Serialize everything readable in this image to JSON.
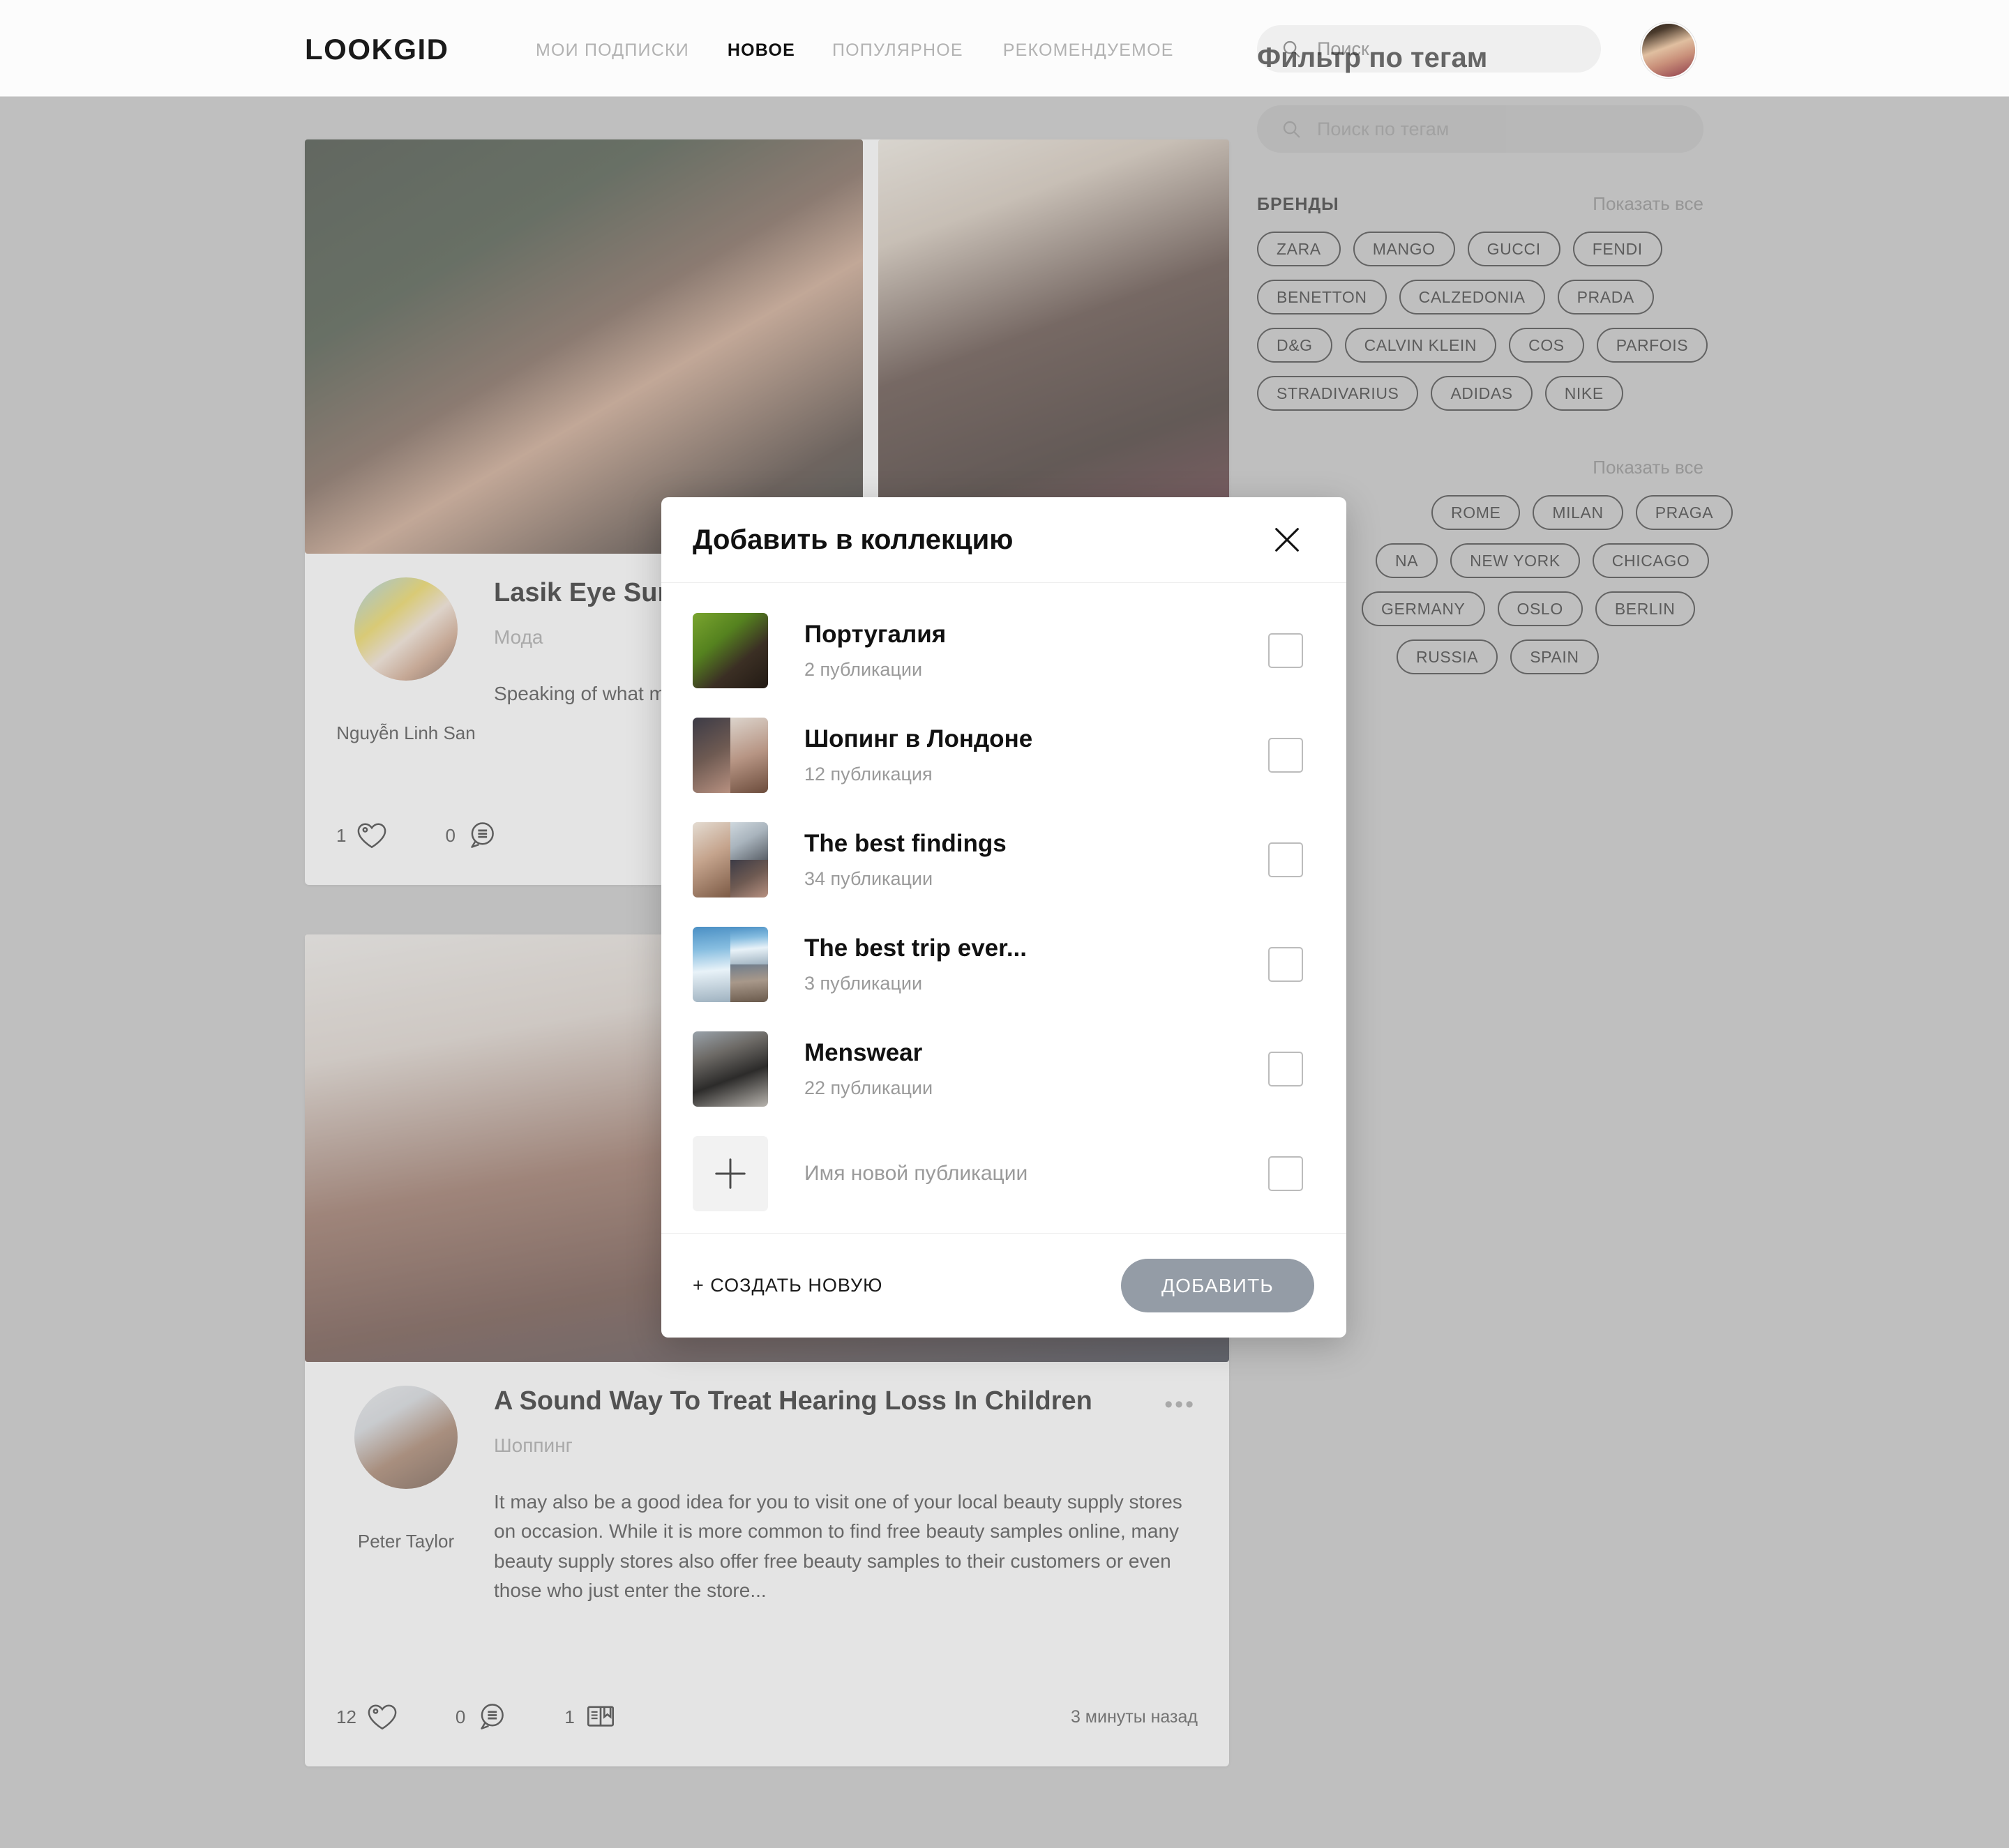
{
  "header": {
    "brand": "LOOKGID",
    "nav": [
      {
        "label": "МОИ ПОДПИСКИ",
        "active": false
      },
      {
        "label": "НОВОЕ",
        "active": true
      },
      {
        "label": "ПОПУЛЯРНОЕ",
        "active": false
      },
      {
        "label": "РЕКОМЕНДУЕМОЕ",
        "active": false
      }
    ],
    "search": {
      "placeholder": "Поиск",
      "value": "",
      "icon": "search-icon"
    },
    "avatar_icon": "user-avatar"
  },
  "feed": {
    "posts": [
      {
        "title": "Lasik Eye Surg",
        "category": "Мода",
        "author": "Nguyễn Linh San",
        "excerpt": "Speaking of what many benefits to beauty samples is different options. ",
        "likes": "1",
        "comments": "0",
        "reads": "",
        "time": ""
      },
      {
        "title": "A Sound Way To Treat Hearing Loss In Children",
        "category": "Шоппинг",
        "author": "Peter Taylor",
        "excerpt": "It may also be a good idea for you to visit one of your local beauty supply stores on occasion. While it is more common to find free beauty samples online, many beauty supply stores also offer free beauty samples to their customers or even those who just enter the store...",
        "likes": "12",
        "comments": "0",
        "reads": "1",
        "time": "3 минуты назад",
        "more_icon": "more-options-icon"
      }
    ]
  },
  "tagpanel": {
    "title": "Фильтр по тегам",
    "search": {
      "placeholder": "Поиск по тегам",
      "value": "",
      "icon": "search-icon"
    },
    "sections": [
      {
        "label": "БРЕНДЫ",
        "show_all": "Показать все",
        "rows": [
          [
            "ZARA",
            "MANGO",
            "GUCCI",
            "FENDI"
          ],
          [
            "BENETTON",
            "CALZEDONIA",
            "PRADA"
          ],
          [
            "D&G",
            "CALVIN KLEIN",
            "COS",
            "PARFOIS"
          ],
          [
            "STRADIVARIUS",
            "ADIDAS",
            "NIKE"
          ]
        ]
      },
      {
        "label": "",
        "show_all": "Показать все",
        "rows": [
          [
            "ROME",
            "MILAN",
            "PRAGA"
          ],
          [
            "NA",
            "NEW YORK",
            "CHICAGO"
          ],
          [
            "",
            "GERMANY",
            "OSLO",
            "BERLIN"
          ],
          [
            "",
            "RUSSIA",
            "SPAIN"
          ]
        ]
      }
    ]
  },
  "modal": {
    "title": "Добавить в коллекцию",
    "close_icon": "close-icon",
    "collections": [
      {
        "name": "Португалия",
        "count": "2 публикации",
        "thumb": "portugal-thumb",
        "checked": false
      },
      {
        "name": "Шопинг в Лондоне",
        "count": "12 публикация",
        "thumb": "london-thumb",
        "checked": false
      },
      {
        "name": "The best findings",
        "count": "34 публикации",
        "thumb": "findings-thumb",
        "checked": false
      },
      {
        "name": "The best trip ever...",
        "count": "3 публикации",
        "thumb": "trip-thumb",
        "checked": false
      },
      {
        "name": "Menswear",
        "count": "22 публикации",
        "thumb": "menswear-thumb",
        "checked": false
      }
    ],
    "new_row": {
      "placeholder": "Имя новой публикации",
      "plus_icon": "plus-icon",
      "checked": false
    },
    "footer": {
      "create_new": "+ СОЗДАТЬ НОВУЮ",
      "add_button": "ДОБАВИТЬ",
      "add_button_color": "#949ca6"
    }
  },
  "colors": {
    "backdrop": "#bfbfbf",
    "header_bg": "#fcfcfc",
    "accent_muted": "#949ca6"
  }
}
